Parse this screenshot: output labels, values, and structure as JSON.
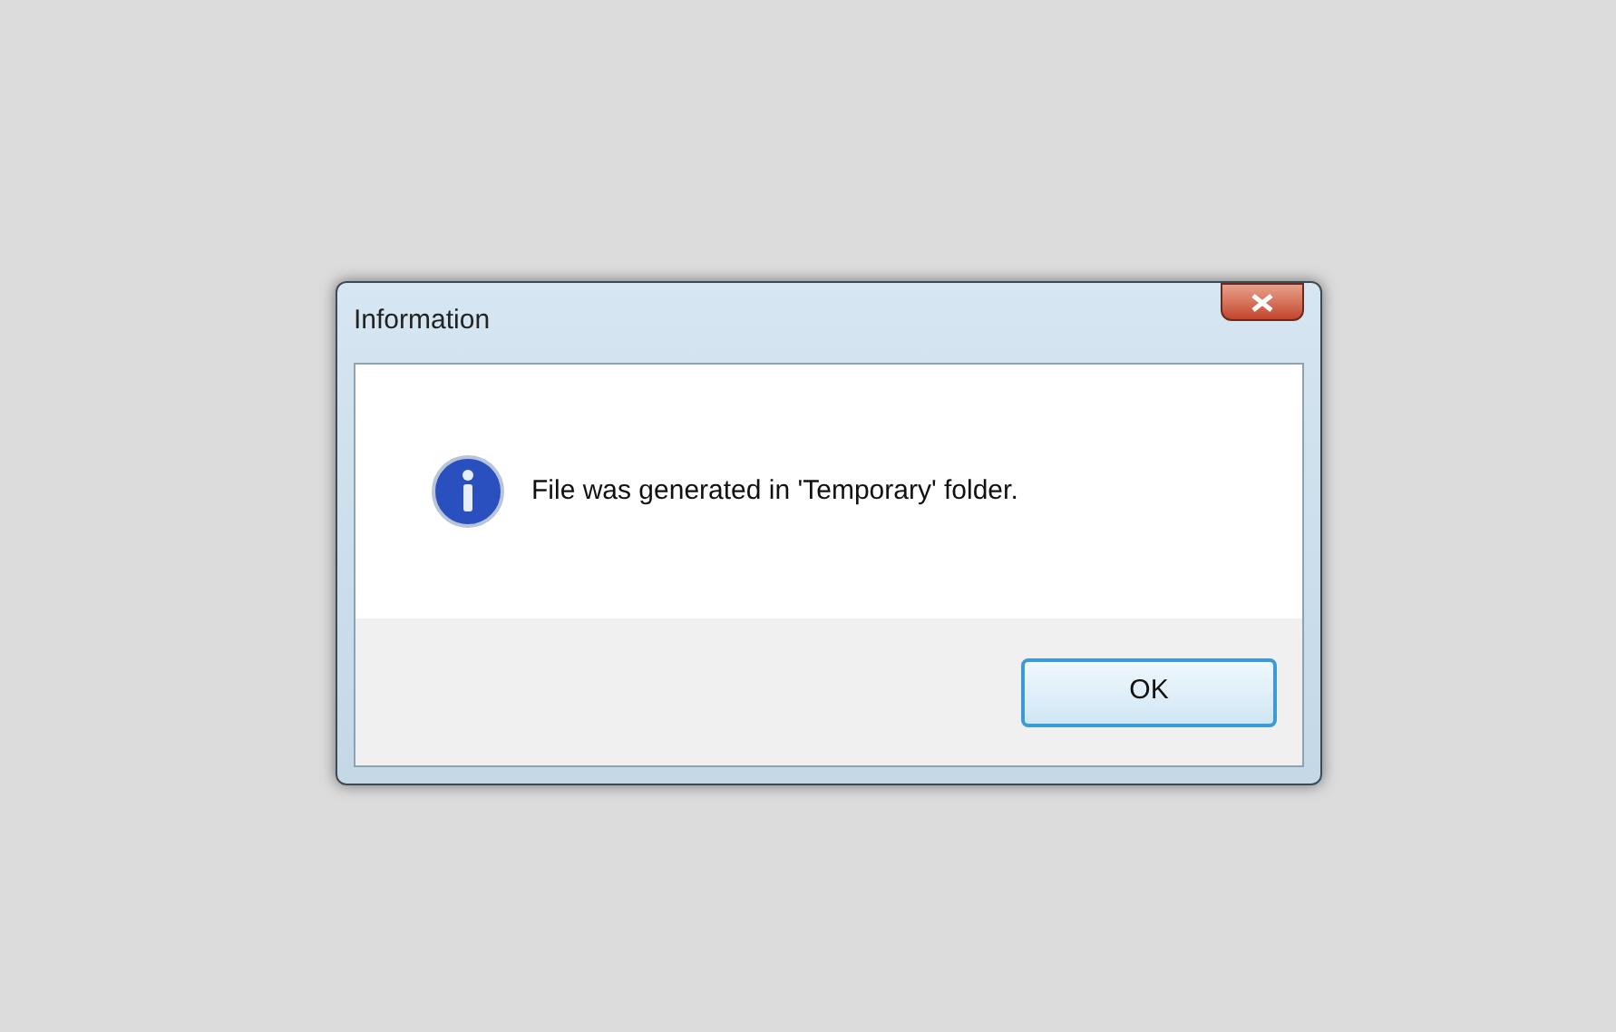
{
  "window": {
    "title": "Information"
  },
  "message": "File was generated in 'Temporary' folder.",
  "buttons": [
    {
      "label": "OK"
    }
  ]
}
